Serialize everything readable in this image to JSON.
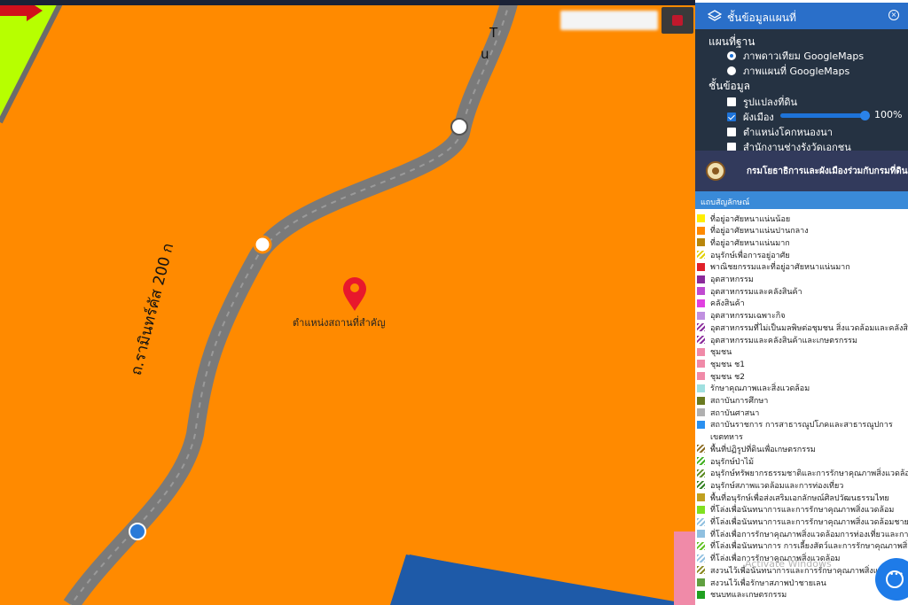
{
  "map": {
    "pin_label": "ตำแหน่งสถานที่สำคัญ",
    "road_label": "ถ.รามินทร์คัส 200 ก",
    "road_label_top": "T",
    "road_label_top2": "u",
    "colors": {
      "zone": "#ff8a00",
      "road": "#6b6b6b",
      "green": "#b7ff00",
      "blue": "#1e5aa8"
    }
  },
  "panel": {
    "header_title": "ชั้นข้อมูลแผนที่",
    "close_label": "×",
    "basemap_title": "แผนที่ฐาน",
    "basemaps": [
      {
        "label": "ภาพดาวเทียม GoogleMaps",
        "selected": true
      },
      {
        "label": "ภาพแผนที่ GoogleMaps",
        "selected": false
      }
    ],
    "layers_title": "ชั้นข้อมูล",
    "layers": [
      {
        "label": "รูปแปลงที่ดิน",
        "checked": false
      },
      {
        "label": "ผังเมือง",
        "checked": true
      },
      {
        "label": "ตำแหน่งโคกหนองนา",
        "checked": false
      },
      {
        "label": "สำนักงานช่างรังวัดเอกชน",
        "checked": false
      }
    ],
    "opacity": "100%",
    "banner_text": "กรมโยธาธิการและผังเมืองร่วมกับกรมที่ดิน",
    "legend_title": "แถบสัญลักษณ์",
    "legend": [
      {
        "label": "ที่อยู่อาศัยหนาแน่นน้อย",
        "color": "#ffee00",
        "hatch": false
      },
      {
        "label": "ที่อยู่อาศัยหนาแน่นปานกลาง",
        "color": "#ff8a00",
        "hatch": false
      },
      {
        "label": "ที่อยู่อาศัยหนาแน่นมาก",
        "color": "#b8860b",
        "hatch": false
      },
      {
        "label": "อนุรักษ์เพื่อการอยู่อาศัย",
        "color": "#e0d000",
        "hatch": true
      },
      {
        "label": "พาณิชยกรรมและที่อยู่อาศัยหนาแน่นมาก",
        "color": "#e0202a",
        "hatch": false
      },
      {
        "label": "อุตสาหกรรม",
        "color": "#8a2a9a",
        "hatch": false
      },
      {
        "label": "อุตสาหกรรมและคลังสินค้า",
        "color": "#c04ad0",
        "hatch": false
      },
      {
        "label": "คลังสินค้า",
        "color": "#e040e0",
        "hatch": false
      },
      {
        "label": "อุตสาหกรรมเฉพาะกิจ",
        "color": "#c090e0",
        "hatch": false
      },
      {
        "label": "อุตสาหกรรมที่ไม่เป็นมลพิษต่อชุมชน สิ่งแวดล้อมและคลังสินค้า",
        "color": "#8a2a9a",
        "hatch": true
      },
      {
        "label": "อุตสาหกรรมและคลังสินค้าและเกษตรกรรม",
        "color": "#8a2a9a",
        "hatch": true
      },
      {
        "label": "ชุมชน",
        "color": "#f08aa8",
        "hatch": false
      },
      {
        "label": "ชุมชน ช1",
        "color": "#f08aa8",
        "hatch": false
      },
      {
        "label": "ชุมชน ช2",
        "color": "#f08aa8",
        "hatch": false
      },
      {
        "label": "รักษาคุณภาพและสิ่งแวดล้อม",
        "color": "#a0e0e0",
        "hatch": false
      },
      {
        "label": "สถาบันการศึกษา",
        "color": "#6a7a20",
        "hatch": false
      },
      {
        "label": "สถาบันศาสนา",
        "color": "#b0b0b0",
        "hatch": false
      },
      {
        "label": "สถาบันราชการ การสาธารณูปโภคและสาธารณูปการ",
        "color": "#2a90f0",
        "hatch": false
      },
      {
        "label": "เขตทหาร",
        "color": "",
        "hatch": false
      },
      {
        "label": "พื้นที่ปฏิรูปที่ดินเพื่อเกษตรกรรม",
        "color": "#8a6a20",
        "hatch": true
      },
      {
        "label": "อนุรักษ์ป่าไม้",
        "color": "#40b020",
        "hatch": true
      },
      {
        "label": "อนุรักษ์ทรัพยากรธรรมชาติและการรักษาคุณภาพสิ่งแวดล้อม",
        "color": "#5a8a20",
        "hatch": true
      },
      {
        "label": "อนุรักษ์สภาพแวดล้อมและการท่องเที่ยว",
        "color": "#308020",
        "hatch": true
      },
      {
        "label": "พื้นที่อนุรักษ์เพื่อส่งเสริมเอกลักษณ์ศิลปวัฒนธรรมไทย",
        "color": "#c0a020",
        "hatch": false
      },
      {
        "label": "ที่โล่งเพื่อนันทนาการและการรักษาคุณภาพสิ่งแวดล้อม",
        "color": "#80e020",
        "hatch": false
      },
      {
        "label": "ที่โล่งเพื่อนันทนาการและการรักษาคุณภาพสิ่งแวดล้อมชายฝั่ง",
        "color": "#90c0e0",
        "hatch": true
      },
      {
        "label": "ที่โล่งเพื่อการรักษาคุณภาพสิ่งแวดล้อมการท่องเที่ยวและการป",
        "color": "#90c0e0",
        "hatch": false
      },
      {
        "label": "ที่โล่งเพื่อนันทนาการ การเลี้ยงสัตว์และการรักษาคุณภาพสิ่งแว",
        "color": "#60c020",
        "hatch": true
      },
      {
        "label": "ที่โล่งเพื่อการรักษาคุณภาพสิ่งแวดล้อม",
        "color": "#90c0e0",
        "hatch": true
      },
      {
        "label": "สงวนไว้เพื่อนันทนาการและการรักษาคุณภาพสิ่งแวดล้อม",
        "color": "#8a8a20",
        "hatch": true
      },
      {
        "label": "สงวนไว้เพื่อรักษาสภาพป่าชายเลน",
        "color": "#60a040",
        "hatch": false
      },
      {
        "label": "ชนบทและเกษตรกรรม",
        "color": "#20a020",
        "hatch": false
      }
    ]
  },
  "watermark": "Activate Windows"
}
